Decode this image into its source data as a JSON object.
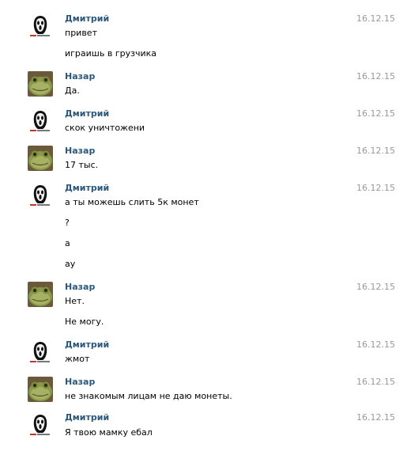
{
  "messages": [
    {
      "author": "Дмитрий",
      "avatar": "scream-mask-avatar",
      "date": "16.12.15",
      "lines": [
        "привет",
        "играишь в грузчика"
      ]
    },
    {
      "author": "Назар",
      "avatar": "frog-avatar",
      "date": "16.12.15",
      "lines": [
        "Да."
      ]
    },
    {
      "author": "Дмитрий",
      "avatar": "scream-mask-avatar",
      "date": "16.12.15",
      "lines": [
        "скок уничтожени"
      ]
    },
    {
      "author": "Назар",
      "avatar": "frog-avatar",
      "date": "16.12.15",
      "lines": [
        "17 тыс."
      ]
    },
    {
      "author": "Дмитрий",
      "avatar": "scream-mask-avatar",
      "date": "16.12.15",
      "lines": [
        "а ты можешь слить 5к монет",
        "?",
        "а",
        "ау"
      ]
    },
    {
      "author": "Назар",
      "avatar": "frog-avatar",
      "date": "16.12.15",
      "lines": [
        "Нет.",
        "Не могу."
      ]
    },
    {
      "author": "Дмитрий",
      "avatar": "scream-mask-avatar",
      "date": "16.12.15",
      "lines": [
        "жмот"
      ]
    },
    {
      "author": "Назар",
      "avatar": "frog-avatar",
      "date": "16.12.15",
      "lines": [
        "не знакомым лицам не даю монеты."
      ]
    },
    {
      "author": "Дмитрий",
      "avatar": "scream-mask-avatar",
      "date": "16.12.15",
      "lines": [
        "Я твою мамку ебал"
      ]
    }
  ],
  "colors": {
    "name": "#2b587a",
    "date": "#999999",
    "text": "#000000"
  }
}
